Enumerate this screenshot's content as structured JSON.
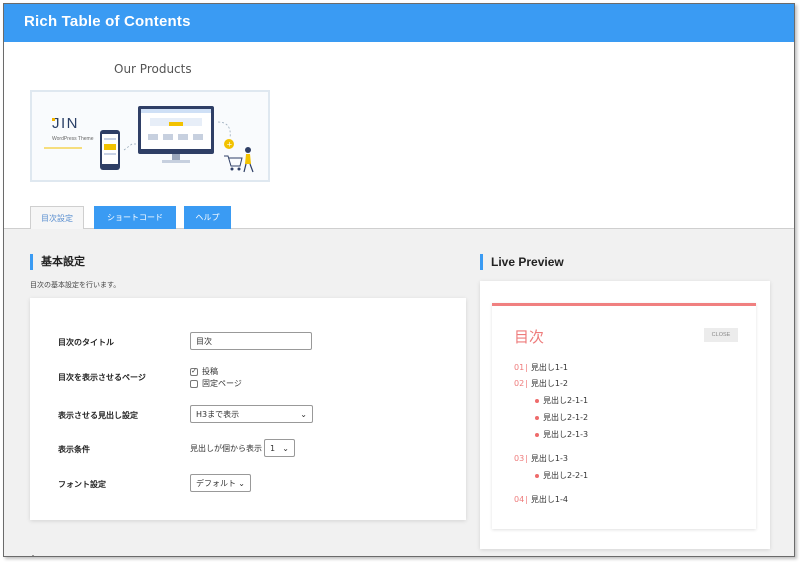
{
  "app": {
    "title": "Rich Table of Contents"
  },
  "products": {
    "label": "Our Products",
    "banner_brand": "JIN",
    "banner_sub": "WordPress Theme"
  },
  "tabs": [
    {
      "label": "目次設定",
      "active": true
    },
    {
      "label": "ショートコード",
      "active": false
    },
    {
      "label": "ヘルプ",
      "active": false
    }
  ],
  "basic": {
    "heading": "基本設定",
    "description": "目次の基本設定を行います。",
    "rows": {
      "title": {
        "label": "目次のタイトル",
        "value": "目次"
      },
      "pages": {
        "label": "目次を表示させるページ",
        "options": [
          {
            "label": "投稿",
            "checked": true
          },
          {
            "label": "固定ページ",
            "checked": false
          }
        ]
      },
      "headings": {
        "label": "表示させる見出し設定",
        "value": "H3まで表示"
      },
      "condition": {
        "label": "表示条件",
        "prefix": "見出しが個から表示",
        "value": "1"
      },
      "font": {
        "label": "フォント設定",
        "value": "デフォルト"
      }
    }
  },
  "preview": {
    "heading": "Live Preview",
    "toc_title": "目次",
    "close_label": "CLOSE",
    "items": [
      {
        "num": "01",
        "text": "見出し1-1"
      },
      {
        "num": "02",
        "text": "見出し1-2"
      },
      {
        "text": "見出し2-1-1"
      },
      {
        "text": "見出し2-1-2"
      },
      {
        "text": "見出し2-1-3"
      },
      {
        "num": "03",
        "text": "見出し1-3"
      },
      {
        "text": "見出し2-2-1"
      },
      {
        "num": "04",
        "text": "見出し1-4"
      }
    ]
  },
  "colors": {
    "accent": "#3a9bf3",
    "toc_accent": "#ee7b7b",
    "background": "#f1f1f1"
  },
  "icons": {
    "check": "check-icon",
    "dropdown": "chevron-down-icon"
  }
}
